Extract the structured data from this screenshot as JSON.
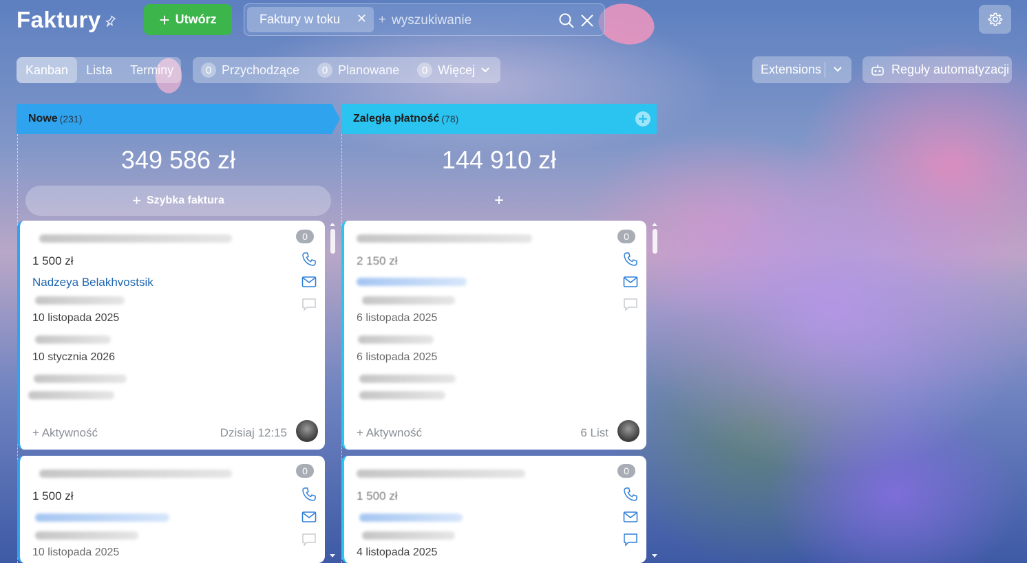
{
  "header": {
    "title": "Faktury",
    "create_label": "Utwórz",
    "filter_chip": "Faktury w toku",
    "search_placeholder": "wyszukiwanie"
  },
  "view_tabs": [
    {
      "label": "Kanban",
      "active": true
    },
    {
      "label": "Lista",
      "active": false
    },
    {
      "label": "Terminy",
      "active": false
    }
  ],
  "counters": [
    {
      "count": "0",
      "label": "Przychodzące"
    },
    {
      "count": "0",
      "label": "Planowane"
    },
    {
      "count": "0",
      "label": "Więcej"
    }
  ],
  "toolbar": {
    "extensions_label": "Extensions",
    "automation_label": "Reguły automatyzacji"
  },
  "colors": {
    "accent_green": "#3cb54a",
    "column_new": "#2fa3ee",
    "column_overdue": "#2bc3f0",
    "link_blue": "#2067b0"
  },
  "columns": [
    {
      "title": "Nowe",
      "count": "(231)",
      "sum": "349 586 zł",
      "quick_label": "Szybka faktura",
      "cards": [
        {
          "comments": "0",
          "amount": "1 500 zł",
          "contact": "Nadzeya Belakhvostsik",
          "date1": "10 listopada 2025",
          "date2": "10 stycznia 2026",
          "activity": "+ Aktywność",
          "when": "Dzisiaj 12:15"
        },
        {
          "comments": "0",
          "amount": "1 500 zł",
          "date1": "10 listopada 2025"
        }
      ]
    },
    {
      "title": "Zaległa płatność",
      "count": "(78)",
      "sum": "144 910 zł",
      "quick_label": "+",
      "cards": [
        {
          "comments": "0",
          "amount": "2 150 zł",
          "date1": "6 listopada 2025",
          "date2": "6 listopada 2025",
          "activity": "+ Aktywność",
          "when": "6 List"
        },
        {
          "comments": "0",
          "amount": "1 500 zł",
          "date1": "4 listopada 2025"
        }
      ]
    }
  ]
}
